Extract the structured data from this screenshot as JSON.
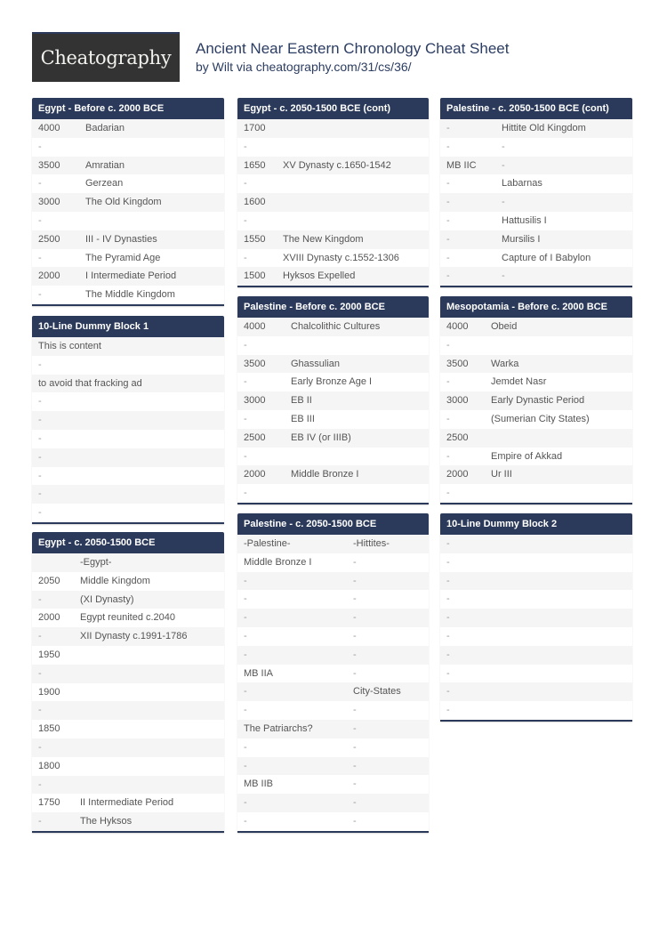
{
  "header": {
    "logo_text": "Cheatography",
    "title": "Ancient Near Eastern Chronology Cheat Sheet",
    "byline_prefix": "by Wilt via ",
    "byline_link": "cheatography.com/31/cs/36/"
  },
  "blocks": {
    "egypt_before_2000": {
      "title": "Egypt - Before c. 2000 BCE",
      "rows": [
        [
          "4000",
          "Badarian"
        ],
        [
          "-",
          ""
        ],
        [
          "3500",
          "Amratian"
        ],
        [
          "-",
          "Gerzean"
        ],
        [
          "3000",
          "The Old Kingdom"
        ],
        [
          "-",
          ""
        ],
        [
          "2500",
          "III - IV Dynasties"
        ],
        [
          "-",
          "The Pyramid Age"
        ],
        [
          "2000",
          "I Intermediate Period"
        ],
        [
          "-",
          "The Middle Kingdom"
        ]
      ]
    },
    "dummy_block_1": {
      "title": "10-Line Dummy Block 1",
      "rows": [
        [
          "This is content"
        ],
        [
          "-"
        ],
        [
          "to avoid that fracking ad"
        ],
        [
          "-"
        ],
        [
          "-"
        ],
        [
          "-"
        ],
        [
          "-"
        ],
        [
          "-"
        ],
        [
          "-"
        ],
        [
          "-"
        ]
      ]
    },
    "egypt_2050_1500": {
      "title": "Egypt - c. 2050-1500 BCE",
      "rows": [
        [
          "",
          "-Egypt-"
        ],
        [
          "2050",
          "Middle Kingdom"
        ],
        [
          "-",
          "(XI Dynasty)"
        ],
        [
          "2000",
          "Egypt reunited c.2040"
        ],
        [
          "-",
          "XII Dynasty c.1991-1786"
        ],
        [
          "1950",
          ""
        ],
        [
          "-",
          ""
        ],
        [
          "1900",
          ""
        ],
        [
          "-",
          ""
        ],
        [
          "1850",
          ""
        ],
        [
          "-",
          ""
        ],
        [
          "1800",
          ""
        ],
        [
          "-",
          ""
        ],
        [
          "1750",
          "II Intermediate Period"
        ],
        [
          "-",
          "The Hyksos"
        ]
      ]
    },
    "egypt_2050_1500_cont": {
      "title": "Egypt - c. 2050-1500 BCE (cont)",
      "rows": [
        [
          "1700",
          ""
        ],
        [
          "-",
          ""
        ],
        [
          "1650",
          "XV Dynasty c.1650-1542"
        ],
        [
          "-",
          ""
        ],
        [
          "1600",
          ""
        ],
        [
          "-",
          ""
        ],
        [
          "1550",
          "The New Kingdom"
        ],
        [
          "-",
          "XVIII Dynasty c.1552-1306"
        ],
        [
          "1500",
          "Hyksos Expelled"
        ]
      ]
    },
    "palestine_before_2000": {
      "title": "Palestine - Before c. 2000 BCE",
      "rows": [
        [
          "4000",
          "Chalcolithic Cultures"
        ],
        [
          "-",
          ""
        ],
        [
          "3500",
          "Ghassulian"
        ],
        [
          "-",
          "Early Bronze Age I"
        ],
        [
          "3000",
          "EB II"
        ],
        [
          "-",
          "EB III"
        ],
        [
          "2500",
          "EB IV (or IIIB)"
        ],
        [
          "-",
          ""
        ],
        [
          "2000",
          "Middle Bronze I"
        ],
        [
          "-",
          ""
        ]
      ]
    },
    "palestine_2050_1500": {
      "title": "Palestine - c. 2050-1500 BCE",
      "rows": [
        [
          "-Palestine-",
          "-Hittites-"
        ],
        [
          "Middle Bronze I",
          "-"
        ],
        [
          "-",
          "-"
        ],
        [
          "-",
          "-"
        ],
        [
          "-",
          "-"
        ],
        [
          "-",
          "-"
        ],
        [
          "-",
          "-"
        ],
        [
          "MB IIA",
          "-"
        ],
        [
          "-",
          "City-States"
        ],
        [
          "-",
          "-"
        ],
        [
          "The Patriarchs?",
          "-"
        ],
        [
          "-",
          "-"
        ],
        [
          "-",
          "-"
        ],
        [
          "MB IIB",
          "-"
        ],
        [
          "-",
          "-"
        ],
        [
          "-",
          "-"
        ]
      ]
    },
    "palestine_2050_1500_cont": {
      "title": "Palestine - c. 2050-1500 BCE (cont)",
      "rows": [
        [
          "-",
          "Hittite Old Kingdom"
        ],
        [
          "-",
          "-"
        ],
        [
          "MB IIC",
          "-"
        ],
        [
          "-",
          "Labarnas"
        ],
        [
          "-",
          "-"
        ],
        [
          "-",
          "Hattusilis I"
        ],
        [
          "-",
          "Mursilis I"
        ],
        [
          "-",
          "Capture of I Babylon"
        ],
        [
          "-",
          "-"
        ]
      ]
    },
    "mesopotamia_before_2000": {
      "title": "Mesopotamia - Before c. 2000 BCE",
      "rows": [
        [
          "4000",
          "Obeid"
        ],
        [
          "-",
          ""
        ],
        [
          "3500",
          "Warka"
        ],
        [
          "-",
          "Jemdet Nasr"
        ],
        [
          "3000",
          "Early Dynastic Period"
        ],
        [
          "-",
          "(Sumerian City States)"
        ],
        [
          "2500",
          ""
        ],
        [
          "-",
          "Empire of Akkad"
        ],
        [
          "2000",
          "Ur III"
        ],
        [
          "-",
          ""
        ]
      ]
    },
    "dummy_block_2": {
      "title": "10-Line Dummy Block 2",
      "rows": [
        [
          "-"
        ],
        [
          "-"
        ],
        [
          "-"
        ],
        [
          "-"
        ],
        [
          "-"
        ],
        [
          "-"
        ],
        [
          "-"
        ],
        [
          "-"
        ],
        [
          "-"
        ],
        [
          "-"
        ]
      ]
    }
  }
}
